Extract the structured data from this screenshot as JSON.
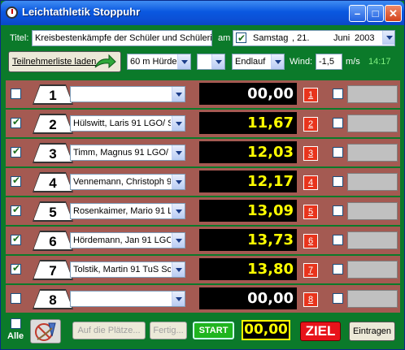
{
  "window": {
    "title": "Leichtathletik Stoppuhr"
  },
  "header": {
    "title_label": "Titel:",
    "title_value": "Kreisbestenkämpfe der Schüler und Schülerin",
    "am_label": "am",
    "date": {
      "day": "Samstag",
      "value": ", 21.",
      "month": "Juni",
      "year": "2003"
    },
    "participants_button": "Teilnehmerliste laden",
    "discipline": "60 m Hürde",
    "extra_select": "",
    "round": "Endlauf",
    "wind_label": "Wind:",
    "wind_value": "-1,5",
    "wind_unit": "m/s",
    "clock": "14:17"
  },
  "lanes": [
    {
      "lane": "1",
      "checked": false,
      "name": "",
      "time": "00,00",
      "place": "1"
    },
    {
      "lane": "2",
      "checked": true,
      "name": "Hülswitt, Laris 91 LGO/ S",
      "time": "11,67",
      "place": "2"
    },
    {
      "lane": "3",
      "checked": true,
      "name": "Timm, Magnus 91 LGO/",
      "time": "12,03",
      "place": "3"
    },
    {
      "lane": "4",
      "checked": true,
      "name": "Vennemann, Christoph 91",
      "time": "12,17",
      "place": "4"
    },
    {
      "lane": "5",
      "checked": true,
      "name": "Rosenkaimer, Mario 91 L",
      "time": "13,09",
      "place": "5"
    },
    {
      "lane": "6",
      "checked": true,
      "name": "Hördemann, Jan 91 LGO",
      "time": "13,73",
      "place": "6"
    },
    {
      "lane": "7",
      "checked": true,
      "name": "Tolstik, Martin 91 TuS Sc",
      "time": "13,80",
      "place": "7"
    },
    {
      "lane": "8",
      "checked": false,
      "name": "",
      "time": "00,00",
      "place": "8"
    }
  ],
  "footer": {
    "alle_label": "Alle",
    "auf_die_plaetze": "Auf die Plätze...",
    "fertig": "Fertig...",
    "start": "START",
    "timer": "00,00",
    "ziel": "ZIEL",
    "eintragen": "Eintragen"
  }
}
